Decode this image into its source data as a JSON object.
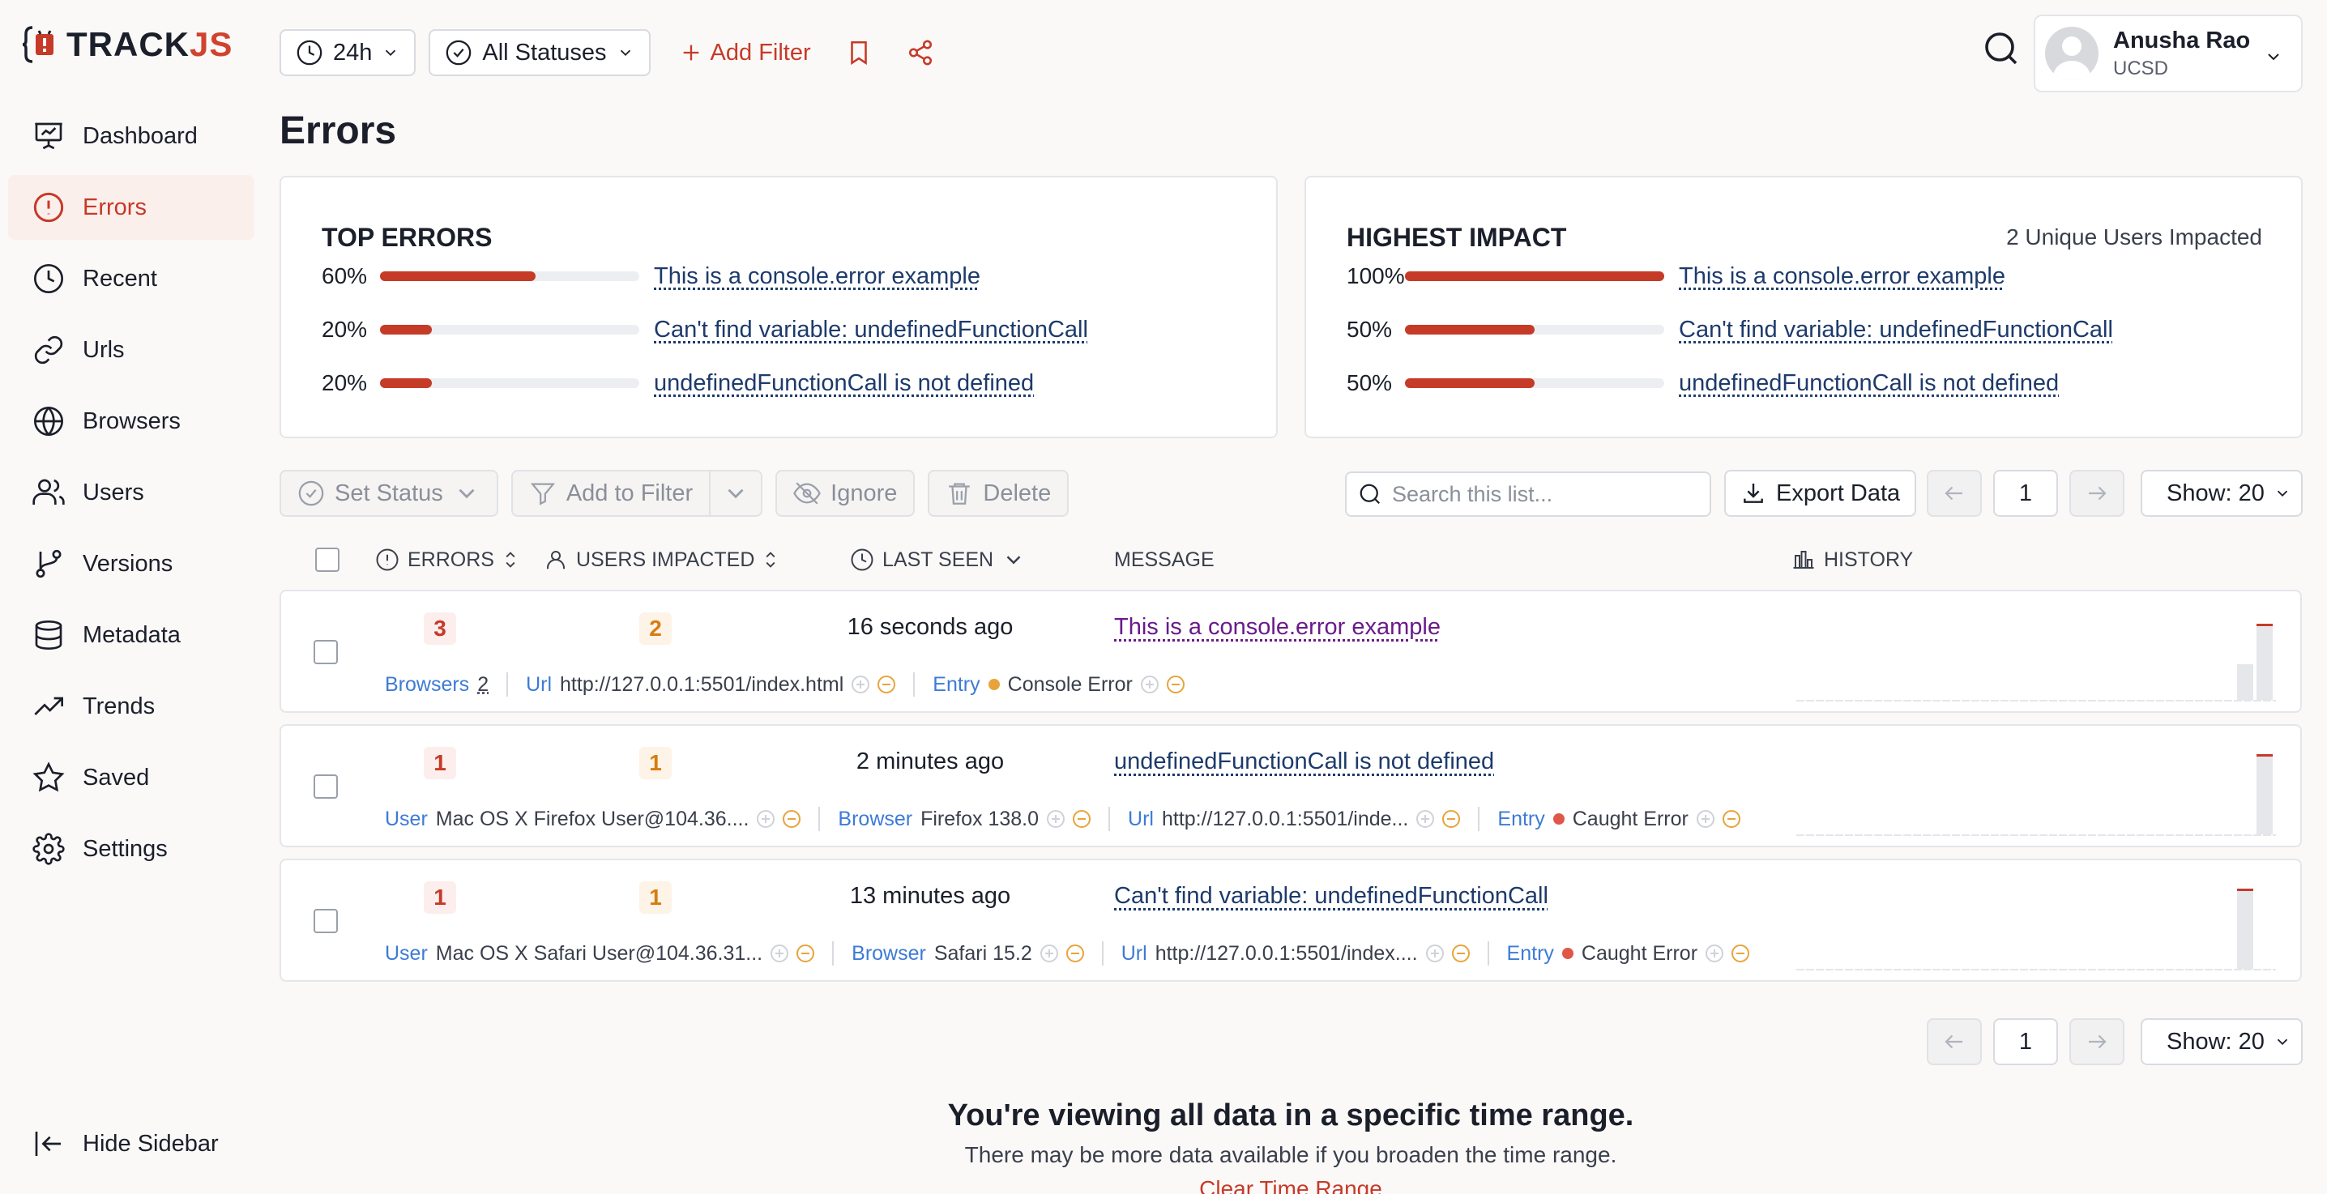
{
  "brand": {
    "name_main": "TRACK",
    "name_accent": "JS"
  },
  "sidebar": {
    "items": [
      {
        "label": "Dashboard",
        "icon": "presentation-icon",
        "active": false
      },
      {
        "label": "Errors",
        "icon": "alert-circle-icon",
        "active": true
      },
      {
        "label": "Recent",
        "icon": "clock-icon",
        "active": false
      },
      {
        "label": "Urls",
        "icon": "link-icon",
        "active": false
      },
      {
        "label": "Browsers",
        "icon": "globe-icon",
        "active": false
      },
      {
        "label": "Users",
        "icon": "users-icon",
        "active": false
      },
      {
        "label": "Versions",
        "icon": "git-branch-icon",
        "active": false
      },
      {
        "label": "Metadata",
        "icon": "database-icon",
        "active": false
      },
      {
        "label": "Trends",
        "icon": "trending-up-icon",
        "active": false
      },
      {
        "label": "Saved",
        "icon": "star-icon",
        "active": false
      },
      {
        "label": "Settings",
        "icon": "gear-icon",
        "active": false
      }
    ],
    "hide_label": "Hide Sidebar"
  },
  "topbar": {
    "time_range": "24h",
    "status_filter": "All Statuses",
    "add_filter": "Add Filter"
  },
  "user": {
    "name": "Anusha Rao",
    "org": "UCSD"
  },
  "page_title": "Errors",
  "top_errors": {
    "title": "TOP ERRORS",
    "items": [
      {
        "pct": "60%",
        "value": 0.6,
        "label": "This is a console.error example"
      },
      {
        "pct": "20%",
        "value": 0.2,
        "label": "Can't find variable: undefinedFunctionCall"
      },
      {
        "pct": "20%",
        "value": 0.2,
        "label": "undefinedFunctionCall is not defined"
      }
    ]
  },
  "highest_impact": {
    "title": "HIGHEST IMPACT",
    "subtitle": "2 Unique Users Impacted",
    "items": [
      {
        "pct": "100%",
        "value": 1.0,
        "label": "This is a console.error example"
      },
      {
        "pct": "50%",
        "value": 0.5,
        "label": "Can't find variable: undefinedFunctionCall"
      },
      {
        "pct": "50%",
        "value": 0.5,
        "label": "undefinedFunctionCall is not defined"
      }
    ]
  },
  "toolbar": {
    "set_status": "Set Status",
    "add_to_filter": "Add to Filter",
    "ignore": "Ignore",
    "delete": "Delete",
    "search_placeholder": "Search this list...",
    "export": "Export Data"
  },
  "pager": {
    "page": "1",
    "show": "Show: 20"
  },
  "columns": {
    "errors": "ERRORS",
    "users": "USERS IMPACTED",
    "last_seen": "LAST SEEN",
    "message": "MESSAGE",
    "history": "HISTORY"
  },
  "rows": [
    {
      "errors": "3",
      "users": "2",
      "last_seen": "16 seconds ago",
      "message": "This is a console.error example",
      "browsers_key": "Browsers",
      "browsers_count": "2",
      "url_key": "Url",
      "url": "http://127.0.0.1:5501/index.html",
      "entry_key": "Entry",
      "entry": "Console Error",
      "history": [
        0,
        0,
        0,
        0.4,
        0.85
      ]
    },
    {
      "errors": "1",
      "users": "1",
      "last_seen": "2 minutes ago",
      "message": "undefinedFunctionCall is not defined",
      "user_key": "User",
      "user": "Mac OS X Firefox User@104.36....",
      "browser_key": "Browser",
      "browser": "Firefox 138.0",
      "url_key": "Url",
      "url": "http://127.0.0.1:5501/inde...",
      "entry_key": "Entry",
      "entry": "Caught Error",
      "history": [
        0,
        0,
        0,
        0,
        0.9
      ]
    },
    {
      "errors": "1",
      "users": "1",
      "last_seen": "13 minutes ago",
      "message": "Can't find variable: undefinedFunctionCall",
      "user_key": "User",
      "user": "Mac OS X Safari User@104.36.31...",
      "browser_key": "Browser",
      "browser": "Safari 15.2",
      "url_key": "Url",
      "url": "http://127.0.0.1:5501/index....",
      "entry_key": "Entry",
      "entry": "Caught Error",
      "history": [
        0,
        0,
        0,
        0.9,
        0
      ]
    }
  ],
  "footer": {
    "title": "You're viewing all data in a specific time range.",
    "subtitle": "There may be more data available if you broaden the time range.",
    "link": "Clear Time Range"
  },
  "colors": {
    "accent": "#c63a28",
    "link": "#1d3a6b",
    "key": "#3d7bd6"
  }
}
